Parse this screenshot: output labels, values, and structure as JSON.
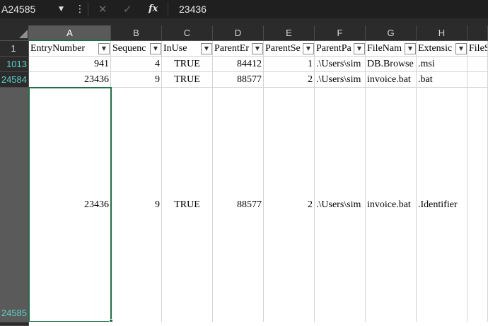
{
  "formula_bar": {
    "name_box": "A24585",
    "formula": "23436",
    "fx_label": "fx"
  },
  "columns": [
    "A",
    "B",
    "C",
    "D",
    "E",
    "F",
    "G",
    "H",
    ""
  ],
  "header_row": {
    "row_number": "1",
    "cells": [
      "EntryNumber",
      "Sequenc",
      "InUse",
      "ParentEr",
      "ParentSe",
      "ParentPa",
      "FileNam",
      "Extensic",
      "FileS"
    ]
  },
  "rows": [
    {
      "row_number": "1013",
      "cells": [
        "941",
        "4",
        "TRUE",
        "84412",
        "1",
        ".\\Users\\sim",
        "DB.Browse",
        ".msi",
        ""
      ]
    },
    {
      "row_number": "24584",
      "cells": [
        "23436",
        "9",
        "TRUE",
        "88577",
        "2",
        ".\\Users\\sim",
        "invoice.bat",
        ".bat",
        ""
      ]
    },
    {
      "row_number": "24585",
      "cells": [
        "23436",
        "9",
        "TRUE",
        "88577",
        "2",
        ".\\Users\\sim",
        "invoice.bat",
        ".Identifier",
        ""
      ]
    }
  ],
  "colors": {
    "selection": "#1e7145",
    "row_number_highlight": "#5ed0c8"
  }
}
